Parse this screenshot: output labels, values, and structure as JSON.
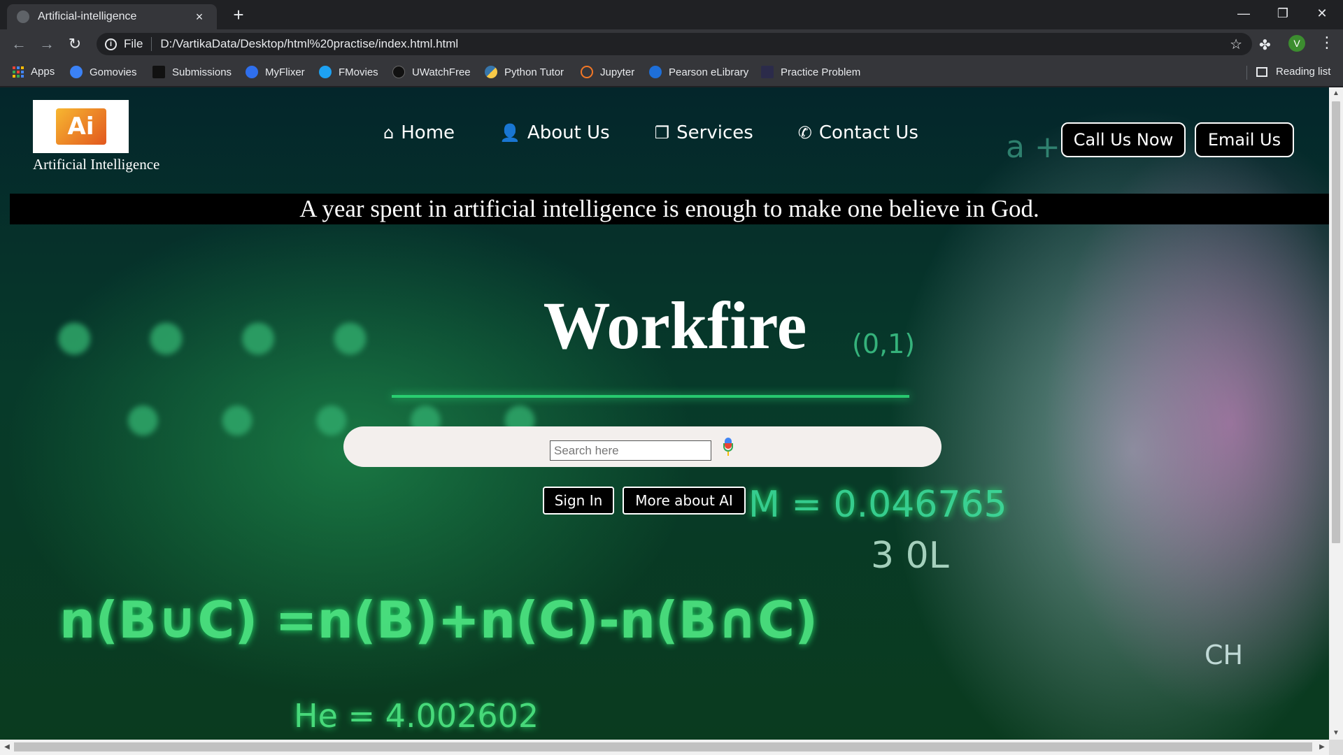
{
  "browser": {
    "tab_title": "Artificial-intelligence",
    "tab_close": "×",
    "new_tab": "+",
    "address_scheme_label": "File",
    "url": "D:/VartikaData/Desktop/html%20practise/index.html.html",
    "profile_initial": "V",
    "window_controls": {
      "minimize": "—",
      "restore": "❐",
      "close": "✕"
    },
    "bookmarks": [
      {
        "label": "Apps",
        "icon": "apps-grid-icon"
      },
      {
        "label": "Gomovies",
        "icon": "play-circle-icon",
        "color": "#3b82f6"
      },
      {
        "label": "Submissions",
        "icon": "hackerrank-icon",
        "color": "#111111"
      },
      {
        "label": "MyFlixer",
        "icon": "film-reel-icon",
        "color": "#2f6fed"
      },
      {
        "label": "FMovies",
        "icon": "play-circle-icon",
        "color": "#1da1f2"
      },
      {
        "label": "UWatchFree",
        "icon": "play-circle-icon",
        "color": "#111111"
      },
      {
        "label": "Python Tutor",
        "icon": "python-icon",
        "color": "#f7c948"
      },
      {
        "label": "Jupyter",
        "icon": "jupyter-icon",
        "color": "#f37726"
      },
      {
        "label": "Pearson eLibrary",
        "icon": "pearson-icon",
        "color": "#1e6fd9"
      },
      {
        "label": "Practice Problem",
        "icon": "page-icon",
        "color": "#2b2b4a"
      }
    ],
    "reading_list": "Reading list"
  },
  "page": {
    "logo_text": "Ai",
    "brand": "Artificial Intelligence",
    "nav": [
      {
        "label": "Home",
        "icon": "home-icon",
        "glyph": "⌂"
      },
      {
        "label": "About Us",
        "icon": "user-icon",
        "glyph": "👤"
      },
      {
        "label": "Services",
        "icon": "copy-icon",
        "glyph": "❐"
      },
      {
        "label": "Contact Us",
        "icon": "phone-icon",
        "glyph": "✆"
      }
    ],
    "cta": {
      "call": "Call Us Now",
      "email": "Email Us"
    },
    "quote": "A year spent in artificial intelligence is enough to make one believe in God.",
    "hero_title": "Workfire",
    "search": {
      "placeholder": "Search here",
      "value": ""
    },
    "buttons": {
      "sign_in": "Sign In",
      "more": "More about AI"
    },
    "background_formulas": {
      "set_formula": "n(B∪C) =n(B)+n(C)-n(B∩C)",
      "helium": "He = 4.002602",
      "m_value": "M = 0.046765",
      "sub_value": "3 0L",
      "coord": "(0,1)",
      "plus": "a +",
      "ch": "CH"
    }
  },
  "colors": {
    "chrome_dark": "#202124",
    "chrome_toolbar": "#35363a",
    "accent_green": "#52f58a",
    "button_bg": "#000000",
    "search_bar_bg": "#f3efed"
  }
}
